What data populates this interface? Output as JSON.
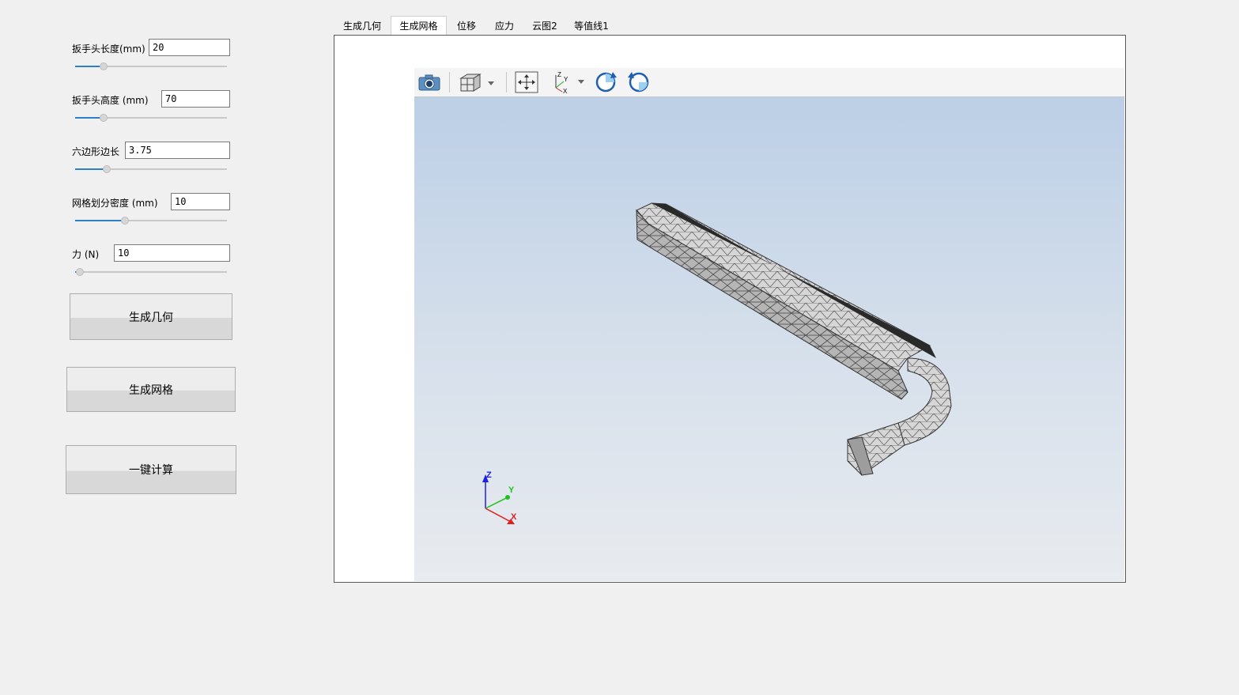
{
  "params": [
    {
      "label": "扳手头长度(mm)",
      "value": "20",
      "slider": 0.19
    },
    {
      "label": "扳手头高度 (mm)",
      "value": "70",
      "slider": 0.19
    },
    {
      "label": "六边形边长",
      "value": "3.75",
      "slider": 0.21
    },
    {
      "label": "网格划分密度 (mm)",
      "value": "10",
      "slider": 0.33
    },
    {
      "label": "力 (N)",
      "value": "10",
      "slider": 0.03
    }
  ],
  "buttons": {
    "generate_geometry": "生成几何",
    "generate_mesh": "生成网格",
    "compute": "一键计算"
  },
  "tabs": [
    "生成几何",
    "生成网格",
    "位移",
    "应力",
    "云图2",
    "等值线1"
  ],
  "active_tab_index": 1,
  "toolbar_icons": [
    "camera-icon",
    "cube-view-icon",
    "fit-view-icon",
    "axes-icon",
    "rotate-cw-icon",
    "rotate-ccw-icon"
  ],
  "axis_labels": {
    "z": "Z",
    "y": "Y",
    "x": "X"
  },
  "colors": {
    "accent": "#2f7ec8",
    "axis_x": "#e02020",
    "axis_y": "#20c020",
    "axis_z": "#2020e0",
    "mesh_light": "#cfcfcf",
    "mesh_dark": "#7a7a7a"
  }
}
